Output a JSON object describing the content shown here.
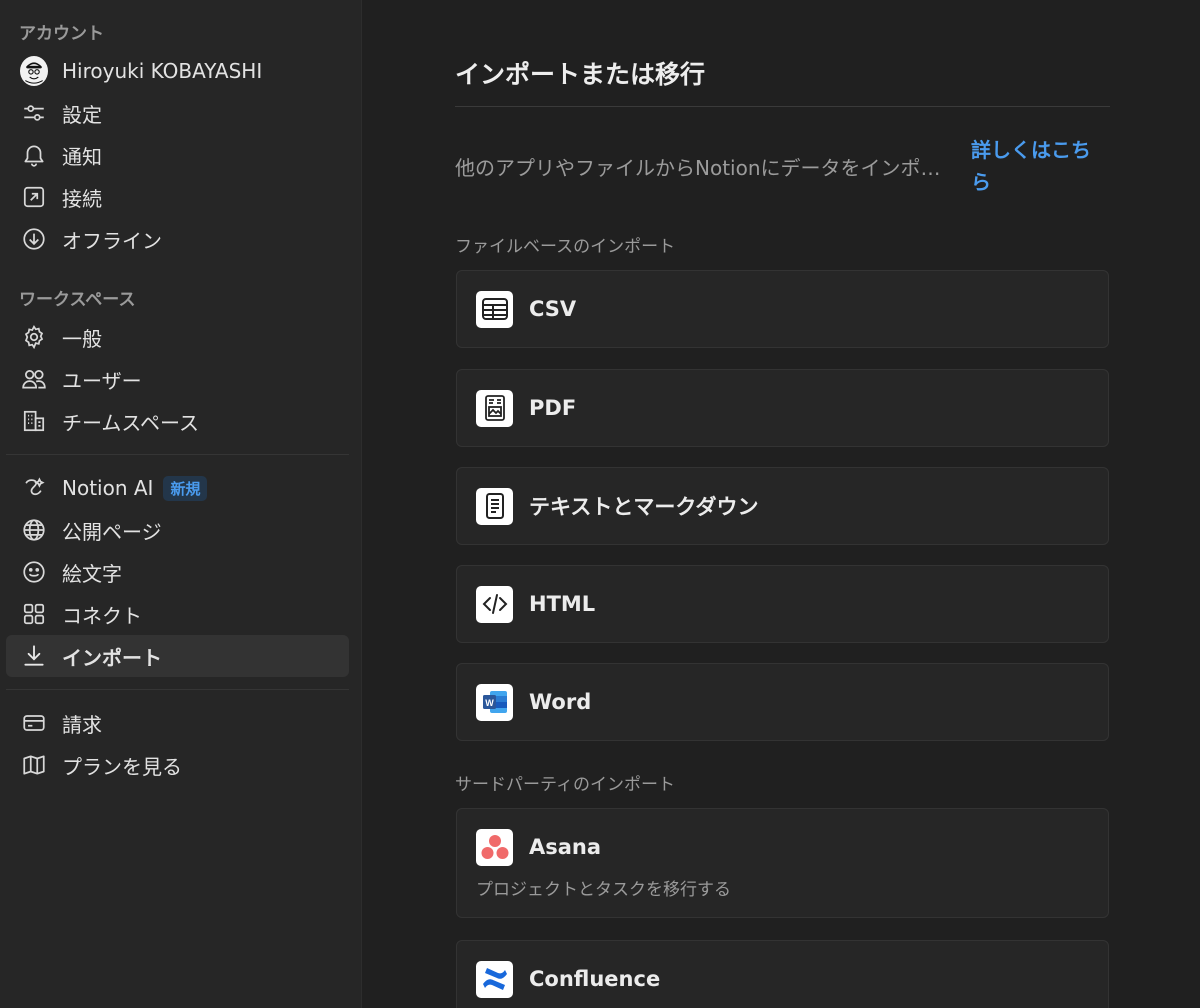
{
  "sidebar": {
    "account_label": "アカウント",
    "account_items": [
      {
        "label": "Hiroyuki KOBAYASHI",
        "icon": "avatar"
      },
      {
        "label": "設定",
        "icon": "sliders-icon"
      },
      {
        "label": "通知",
        "icon": "bell-icon"
      },
      {
        "label": "接続",
        "icon": "external-link-icon"
      },
      {
        "label": "オフライン",
        "icon": "download-circle-icon"
      }
    ],
    "workspace_label": "ワークスペース",
    "workspace_items": [
      {
        "label": "一般",
        "icon": "gear-icon"
      },
      {
        "label": "ユーザー",
        "icon": "users-icon"
      },
      {
        "label": "チームスペース",
        "icon": "building-icon"
      }
    ],
    "feature_items": [
      {
        "label": "Notion AI",
        "icon": "notion-ai-icon",
        "badge": "新規"
      },
      {
        "label": "公開ページ",
        "icon": "globe-icon"
      },
      {
        "label": "絵文字",
        "icon": "smiley-icon"
      },
      {
        "label": "コネクト",
        "icon": "grid-icon"
      },
      {
        "label": "インポート",
        "icon": "import-icon",
        "active": true
      }
    ],
    "billing_items": [
      {
        "label": "請求",
        "icon": "credit-card-icon"
      },
      {
        "label": "プランを見る",
        "icon": "map-icon"
      }
    ]
  },
  "main": {
    "title": "インポートまたは移行",
    "description": "他のアプリやファイルからNotionにデータをインポート",
    "learn_more": "詳しくはこちら",
    "file_group_label": "ファイルベースのインポート",
    "file_imports": [
      {
        "name": "CSV",
        "icon": "table-icon"
      },
      {
        "name": "PDF",
        "icon": "pdf-icon"
      },
      {
        "name": "テキストとマークダウン",
        "icon": "text-doc-icon"
      },
      {
        "name": "HTML",
        "icon": "code-icon"
      },
      {
        "name": "Word",
        "icon": "word-icon"
      }
    ],
    "third_party_label": "サードパーティのインポート",
    "third_party_imports": [
      {
        "name": "Asana",
        "subtitle": "プロジェクトとタスクを移行する",
        "icon": "asana-icon"
      },
      {
        "name": "Confluence",
        "icon": "confluence-icon"
      }
    ]
  },
  "colors": {
    "accent": "#4a9bee",
    "sidebar_bg": "#262626",
    "main_bg": "#202020",
    "asana": "#f06a6a",
    "word": "#2b579a",
    "confluence": "#1868db"
  }
}
